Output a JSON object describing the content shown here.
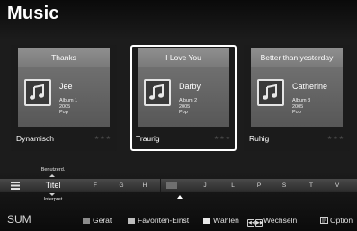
{
  "page": {
    "title": "Music"
  },
  "albums": [
    {
      "song": "Thanks",
      "artist": "Jee",
      "album": "Album 1",
      "year": "2005",
      "genre": "Pop",
      "mood": "Dynamisch",
      "rating": "★★★",
      "icon": "music-note-icon"
    },
    {
      "song": "I Love You",
      "artist": "Darby",
      "album": "Album 2",
      "year": "2005",
      "genre": "Pop",
      "mood": "Traurig",
      "rating": "★★★",
      "icon": "music-note-icon"
    },
    {
      "song": "Better than yesterday",
      "artist": "Catherine",
      "album": "Album 3",
      "year": "2005",
      "genre": "Pop",
      "mood": "Ruhig",
      "rating": "★★★",
      "icon": "music-note-icon"
    }
  ],
  "sortbar": {
    "option_above": "Benutzerd.",
    "current": "Titel",
    "option_below": "Interpret",
    "letters": [
      "F",
      "G",
      "H",
      "",
      "J",
      "L",
      "P",
      "S",
      "T",
      "V"
    ],
    "icon": "list-icon"
  },
  "helpbar": {
    "source": "SUM",
    "hints": [
      {
        "label": "Gerät",
        "color": "#8c8c8c"
      },
      {
        "label": "Favoriten-Einst",
        "color": "#bdbdbd"
      },
      {
        "label": "Wählen",
        "color": "#e8e8e8"
      },
      {
        "label": "Wechseln",
        "icon": "skip-buttons-icon"
      },
      {
        "label": "Option",
        "icon": "tools-icon"
      }
    ]
  },
  "colors": {
    "background": "#1c1c1c",
    "card_header": "#8a8a8a",
    "card_body": "#636363",
    "selected_border": "#ffffff"
  }
}
